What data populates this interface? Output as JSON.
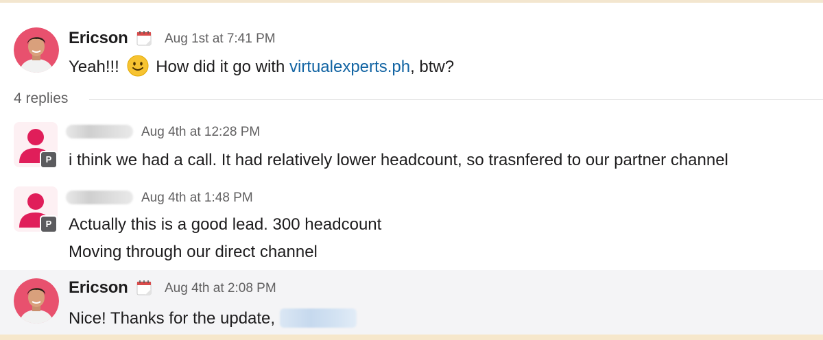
{
  "thread": {
    "parent": {
      "sender": "Ericson",
      "status_icon": "calendar-icon",
      "timestamp": "Aug 1st at 7:41 PM",
      "text_before": "Yeah!!!",
      "emoji": "slightly-smiling-face-icon",
      "text_middle": "How did it go with",
      "link_text": "virtualexperts.ph",
      "text_after": ", btw?"
    },
    "replies_label": "4 replies",
    "replies": [
      {
        "sender_redacted": true,
        "badge": "P",
        "timestamp": "Aug 4th at 12:28 PM",
        "lines": [
          "i think we had a call. It had relatively lower headcount, so trasnfered to our partner channel"
        ]
      },
      {
        "sender_redacted": true,
        "badge": "P",
        "timestamp": "Aug 4th at 1:48 PM",
        "lines": [
          "Actually this is a good lead. 300 headcount",
          "Moving through our direct channel"
        ]
      },
      {
        "sender": "Ericson",
        "status_icon": "calendar-icon",
        "timestamp": "Aug 4th at 2:08 PM",
        "text": "Nice! Thanks for the update,",
        "mention_redacted": true
      }
    ]
  },
  "colors": {
    "link": "#1264a3",
    "muted_text": "#616061",
    "avatar_pink": "#e01e5a",
    "highlight_bg": "#f4f4f6"
  }
}
